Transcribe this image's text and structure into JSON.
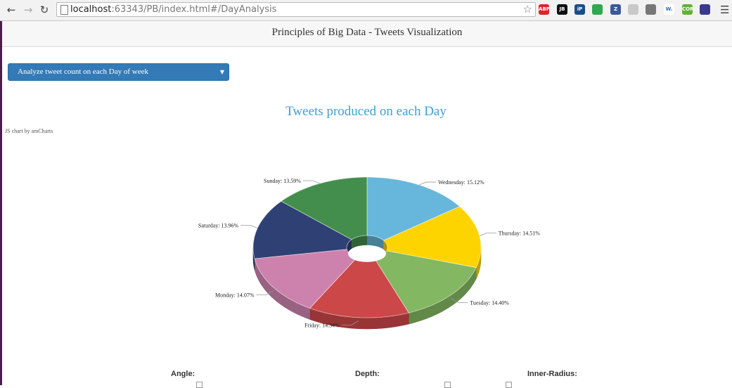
{
  "browser": {
    "url_host": "localhost",
    "url_rest": ":63343/PB/index.html#/DayAnalysis",
    "extensions": [
      {
        "name": "adblock-plus-icon",
        "text": "ABP",
        "color": "#d9262b"
      },
      {
        "name": "jetbrains-icon",
        "text": "JB",
        "color": "#111111"
      },
      {
        "name": "ip-icon",
        "text": "iP",
        "color": "#1a4e8a"
      },
      {
        "name": "toggle-icon",
        "text": "",
        "color": "#2fa84f"
      },
      {
        "name": "zotero-icon",
        "text": "Z",
        "color": "#3b5998"
      },
      {
        "name": "leaf-icon",
        "text": "",
        "color": "#c9c9c9"
      },
      {
        "name": "book-icon",
        "text": "",
        "color": "#777777"
      },
      {
        "name": "w-icon",
        "text": "W.",
        "color": "#ffffff"
      },
      {
        "name": "cors-icon",
        "text": "CORS",
        "color": "#5fb336"
      },
      {
        "name": "globe-icon",
        "text": "",
        "color": "#3a3a8a"
      }
    ]
  },
  "header": {
    "title": "Principles of Big Data - Tweets Visualization"
  },
  "select": {
    "value": "Analyze tweet count on each Day of week"
  },
  "chart_credit": "JS chart by amCharts",
  "chart_data": {
    "type": "pie",
    "title": "Tweets produced on each Day",
    "style": "3d-donut",
    "slices": [
      {
        "label": "Wednesday",
        "value": 15.12,
        "color": "#67b7dc"
      },
      {
        "label": "Thursday",
        "value": 14.51,
        "color": "#fdd400"
      },
      {
        "label": "Tuesday",
        "value": 14.4,
        "color": "#84b761"
      },
      {
        "label": "Friday",
        "value": 14.34,
        "color": "#cc4748"
      },
      {
        "label": "Monday",
        "value": 14.07,
        "color": "#cd82ad"
      },
      {
        "label": "Saturday",
        "value": 13.96,
        "color": "#2f4074"
      },
      {
        "label": "Sunday",
        "value": 13.59,
        "color": "#448e4d"
      }
    ]
  },
  "controls": {
    "angle_label": "Angle:",
    "depth_label": "Depth:",
    "inner_radius_label": "Inner-Radius:"
  }
}
